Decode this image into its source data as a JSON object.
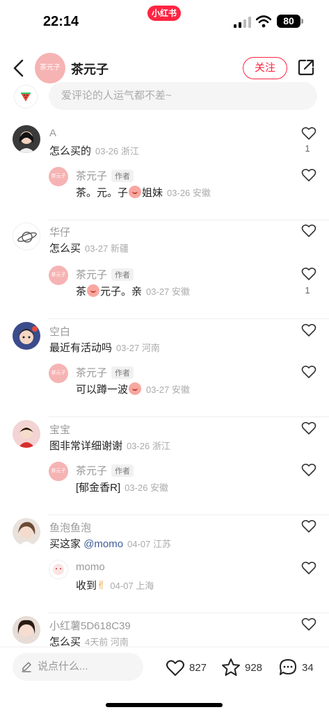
{
  "status": {
    "time": "22:14",
    "app_badge": "小红书",
    "battery": "80"
  },
  "header": {
    "author_name": "茶元子",
    "avatar_text": "茶元子",
    "follow_label": "关注"
  },
  "top_input": {
    "placeholder": "爱评论的人运气都不差~"
  },
  "comments": [
    {
      "name": "A",
      "text": "怎么买的",
      "date": "03-26",
      "region": "浙江",
      "likes": "1",
      "reply": {
        "name": "茶元子",
        "tag": "作者",
        "text_a": "茶。元。子",
        "text_b": "姐妹",
        "date": "03-26",
        "region": "安徽",
        "likes": ""
      }
    },
    {
      "name": "华仔",
      "text": "怎么买",
      "date": "03-27",
      "region": "新疆",
      "likes": "",
      "reply": {
        "name": "茶元子",
        "tag": "作者",
        "text_a": "茶",
        "text_b": "元子。亲",
        "date": "03-27",
        "region": "安徽",
        "likes": "1"
      }
    },
    {
      "name": "空白",
      "text": "最近有活动吗",
      "date": "03-27",
      "region": "河南",
      "likes": "",
      "reply": {
        "name": "茶元子",
        "tag": "作者",
        "text_a": "可以蹲一波",
        "text_b": "",
        "date": "03-27",
        "region": "安徽",
        "likes": ""
      }
    },
    {
      "name": "宝宝",
      "text": "图非常详细谢谢",
      "date": "03-26",
      "region": "浙江",
      "likes": "",
      "reply": {
        "name": "茶元子",
        "tag": "作者",
        "text_a": "[郁金香R]",
        "text_b": "",
        "date": "03-26",
        "region": "安徽",
        "likes": ""
      }
    },
    {
      "name": "鱼泡鱼泡",
      "text": "买这家",
      "mention": "@momo",
      "date": "04-07",
      "region": "江苏",
      "likes": "",
      "reply": {
        "name": "momo",
        "tag": "",
        "text_a": "收到",
        "text_b": "",
        "date": "04-07",
        "region": "上海",
        "likes": ""
      }
    },
    {
      "name": "小红薯5D618C39",
      "text": "怎么买",
      "date": "4天前",
      "region": "河南",
      "likes": ""
    }
  ],
  "bottom": {
    "placeholder": "说点什么...",
    "likes": "827",
    "stars": "928",
    "comments": "34"
  }
}
